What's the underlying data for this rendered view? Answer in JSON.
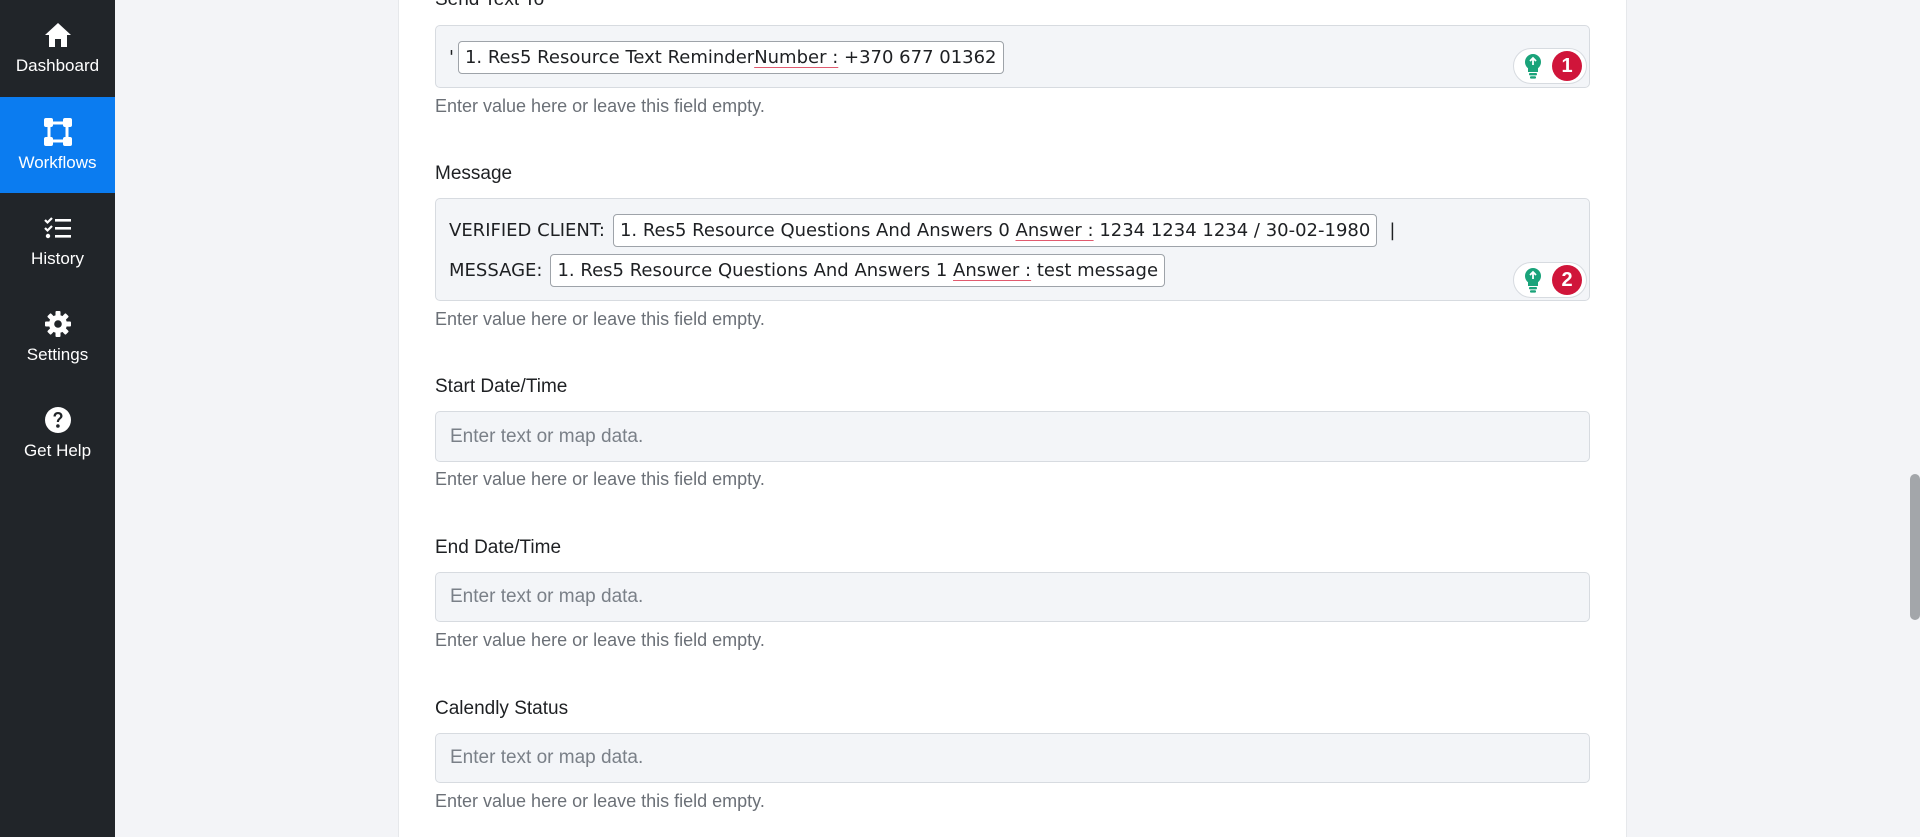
{
  "sidebar": {
    "items": [
      {
        "label": "Dashboard",
        "icon": "home-icon",
        "active": false
      },
      {
        "label": "Workflows",
        "icon": "workflow-icon",
        "active": true
      },
      {
        "label": "History",
        "icon": "checklist-icon",
        "active": false
      },
      {
        "label": "Settings",
        "icon": "gear-icon",
        "active": false
      },
      {
        "label": "Get Help",
        "icon": "question-icon",
        "active": false
      }
    ]
  },
  "form": {
    "send_text_to": {
      "label": "Send Text To",
      "prefix": "'",
      "pill_pre": "1. Res5 Resource Text Reminder ",
      "pill_underlined": "Number :",
      "pill_post": " +370 677 01362",
      "badge_count": "1",
      "hint": "Enter value here or leave this field empty."
    },
    "message": {
      "label": "Message",
      "line1_text": "VERIFIED CLIENT:",
      "pill1_pre": "1. Res5 Resource Questions And Answers 0 ",
      "pill1_underlined": "Answer :",
      "pill1_post": " 1234 1234 1234 / 30-02-1980",
      "line1_suffix": "|",
      "line2_text": "MESSAGE:",
      "pill2_pre": "1. Res5 Resource Questions And Answers 1 ",
      "pill2_underlined": "Answer :",
      "pill2_post": " test message",
      "badge_count": "2",
      "hint": "Enter value here or leave this field empty."
    },
    "start_datetime": {
      "label": "Start Date/Time",
      "placeholder": "Enter text or map data.",
      "hint": "Enter value here or leave this field empty."
    },
    "end_datetime": {
      "label": "End Date/Time",
      "placeholder": "Enter text or map data.",
      "hint": "Enter value here or leave this field empty."
    },
    "calendly_status": {
      "label": "Calendly Status",
      "placeholder": "Enter text or map data.",
      "hint": "Enter value here or leave this field empty."
    }
  },
  "colors": {
    "sidebar_bg": "#212529",
    "active_nav": "#0b7cf0",
    "badge": "#d0153a",
    "bulb": "#1aa37a"
  }
}
